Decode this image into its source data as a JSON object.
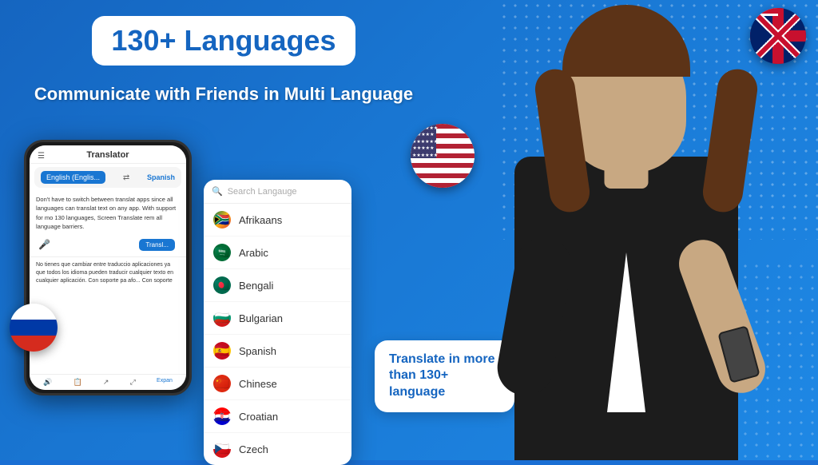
{
  "app": {
    "title": "130+ Languages",
    "subtitle": "Communicate with Friends in Multi Language",
    "translate_bubble": "Translate in more than 130+ language"
  },
  "phone": {
    "app_title": "Translator",
    "menu_icon": "☰",
    "lang_from": "English (Englis...",
    "lang_swap": "⇄",
    "lang_to": "Spanish",
    "source_text": "Don't have to switch between translat apps since all languages can translat text on any app. With support for mo 130 languages, Screen Translate rem all language barriers.",
    "translate_btn": "Transl...",
    "translated_text": "No tienes que cambiar entre traduccio aplicaciones ya que todos los idioma pueden traducir cualquier texto en cualquier aplicación. Con soporte pa afo... Con soporte",
    "expand_label": "Expan"
  },
  "search": {
    "placeholder": "Search Langauge"
  },
  "languages": [
    {
      "name": "Afrikaans",
      "flag_class": "flag-za",
      "flag_emoji": "🇿🇦"
    },
    {
      "name": "Arabic",
      "flag_class": "flag-sa",
      "flag_emoji": "🇸🇦"
    },
    {
      "name": "Bengali",
      "flag_class": "flag-bd",
      "flag_emoji": "🇧🇩"
    },
    {
      "name": "Bulgarian",
      "flag_class": "flag-bg",
      "flag_emoji": "🇧🇬"
    },
    {
      "name": "Spanish",
      "flag_class": "flag-es",
      "flag_emoji": "🇪🇸"
    },
    {
      "name": "Chinese",
      "flag_class": "flag-cn",
      "flag_emoji": "🇨🇳"
    },
    {
      "name": "Croatian",
      "flag_class": "flag-hr",
      "flag_emoji": "🇭🇷"
    },
    {
      "name": "Czech",
      "flag_class": "flag-cz",
      "flag_emoji": "🇨🇿"
    }
  ],
  "icons": {
    "search": "🔍",
    "mic": "🎤",
    "speaker": "🔊",
    "copy": "📋",
    "share": "↗",
    "expand": "⤢"
  }
}
